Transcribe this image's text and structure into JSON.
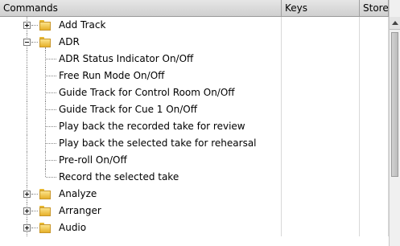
{
  "columns": {
    "commands": "Commands",
    "keys": "Keys",
    "store": "Store"
  },
  "tree": {
    "folders": [
      {
        "label": "Add Track",
        "expanded": false
      },
      {
        "label": "ADR",
        "expanded": true,
        "children": [
          "ADR Status Indicator On/Off",
          "Free Run Mode On/Off",
          "Guide Track for Control Room On/Off",
          "Guide Track for Cue 1 On/Off",
          "Play back the recorded take for review",
          "Play back the selected take for rehearsal",
          "Pre-roll On/Off",
          "Record the selected take"
        ]
      },
      {
        "label": "Analyze",
        "expanded": false
      },
      {
        "label": "Arranger",
        "expanded": false
      },
      {
        "label": "Audio",
        "expanded": false
      }
    ]
  },
  "icons": {
    "expander_collapsed": "plus-box-icon",
    "expander_expanded": "minus-box-icon",
    "folder": "folder-icon"
  },
  "colors": {
    "folder": "#f2c94c",
    "header_bg": "#dcdcdc",
    "grid_line": "#d8d8d8"
  }
}
